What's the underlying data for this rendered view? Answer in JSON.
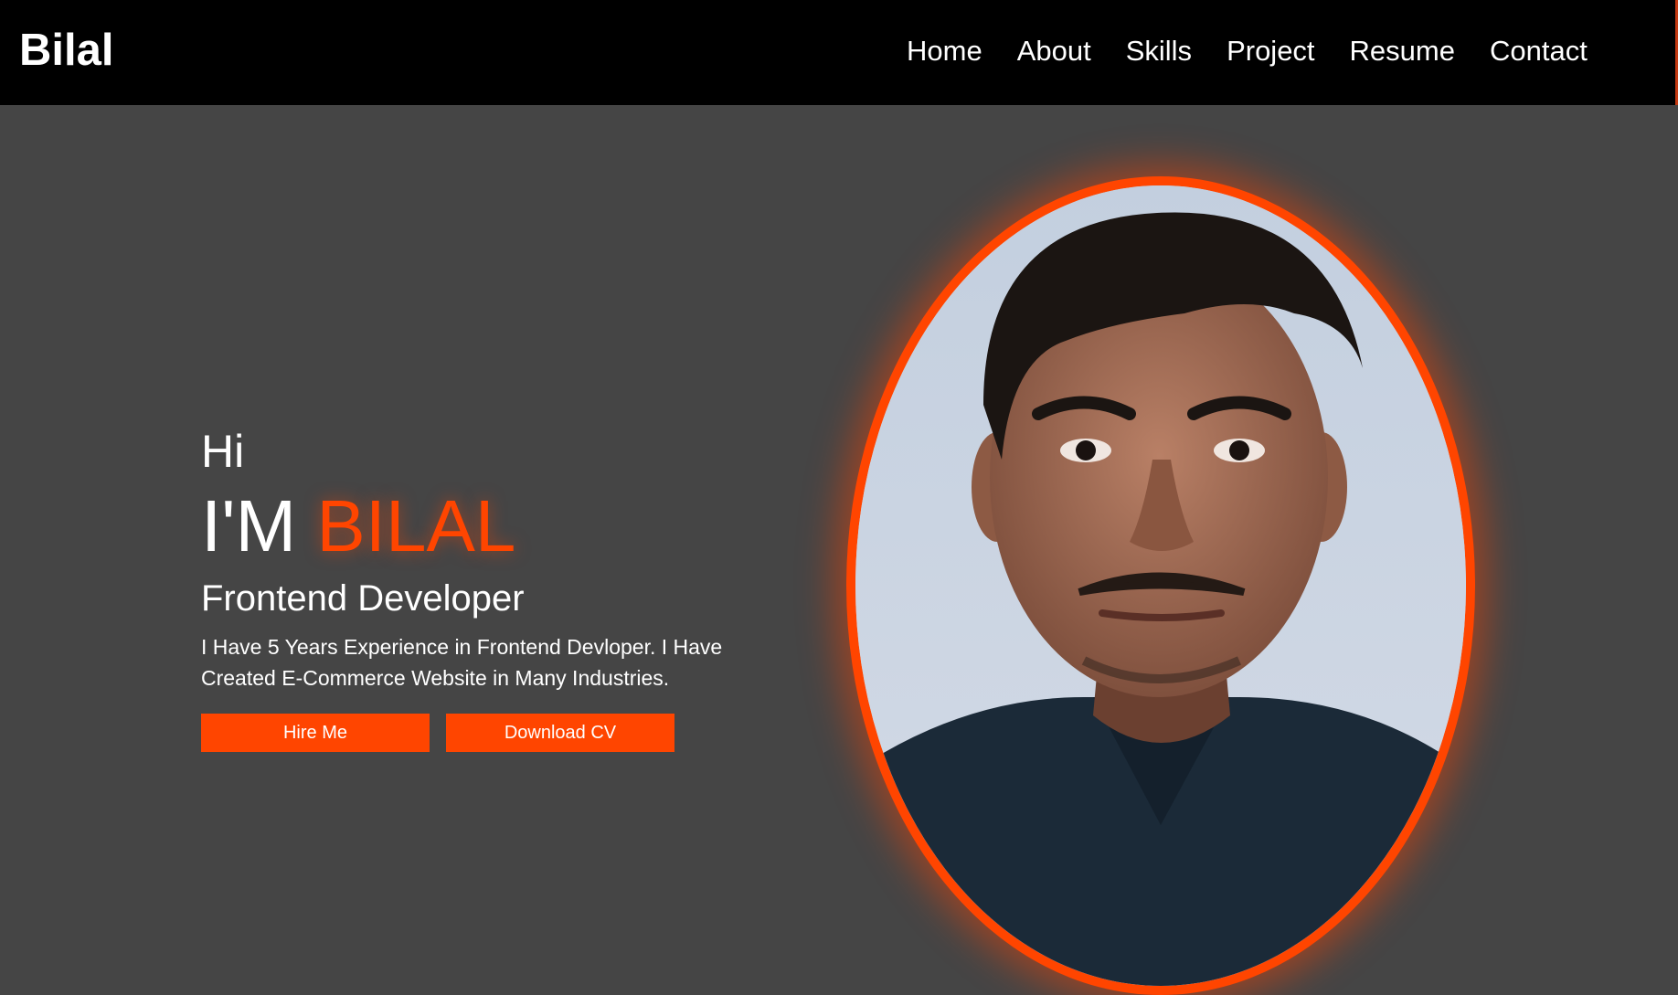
{
  "nav": {
    "logo": "Bilal",
    "links": [
      "Home",
      "About",
      "Skills",
      "Project",
      "Resume",
      "Contact"
    ]
  },
  "hero": {
    "greeting": "Hi",
    "headline_prefix": "I'M",
    "headline_name": "BILAL",
    "role": "Frontend Developer",
    "bio": "I Have 5 Years Experience in Frontend Devloper. I Have Created E-Commerce Website in Many Industries.",
    "hire_label": "Hire Me",
    "cv_label": "Download CV"
  },
  "colors": {
    "accent": "#ff4500",
    "nav_bg": "#000000",
    "hero_bg": "#454545"
  },
  "icons": {
    "portrait": "profile-photo"
  }
}
